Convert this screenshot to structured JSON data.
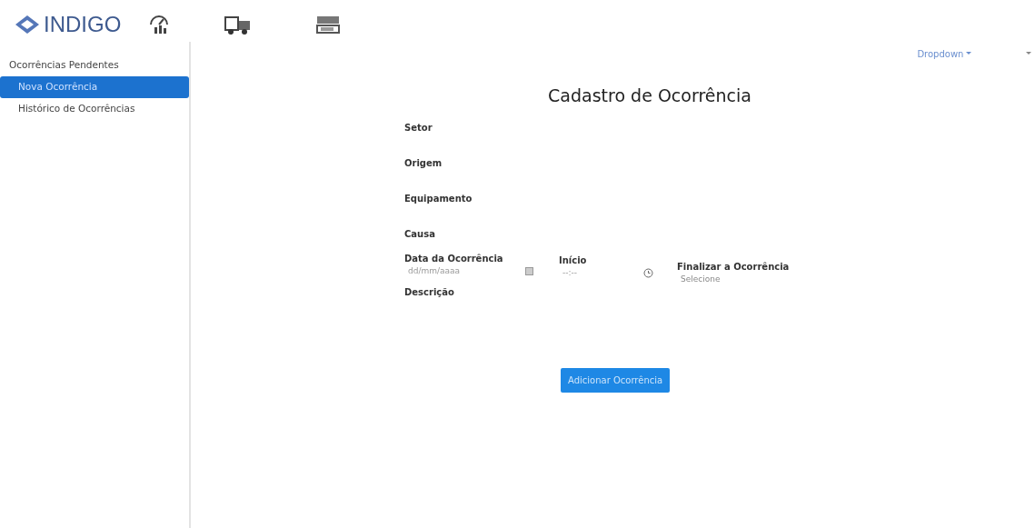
{
  "brand": {
    "name": "INDIGO"
  },
  "navbar": {
    "dropdown": "Dropdown"
  },
  "sidebar": {
    "items": [
      {
        "label": "Ocorrências Pendentes",
        "selected": false
      },
      {
        "label": "Nova Ocorrência",
        "selected": true
      },
      {
        "label": "Histórico de Ocorrências",
        "selected": false
      }
    ]
  },
  "form": {
    "title": "Cadastro de Ocorrência",
    "labels": [
      "Setor",
      "Origem",
      "Equipamento",
      "Causa"
    ],
    "inputs": [
      {
        "kind": "date",
        "label": "Data da Ocorrência",
        "placeholder": "dd/mm/aaaa"
      },
      {
        "kind": "time",
        "label": "Início",
        "placeholder": "--:--"
      },
      {
        "kind": "select",
        "label": "Finalizar a Ocorrência",
        "value": "Selecione"
      }
    ],
    "description_label": "Descrição",
    "submit": "Adicionar Ocorrência"
  }
}
